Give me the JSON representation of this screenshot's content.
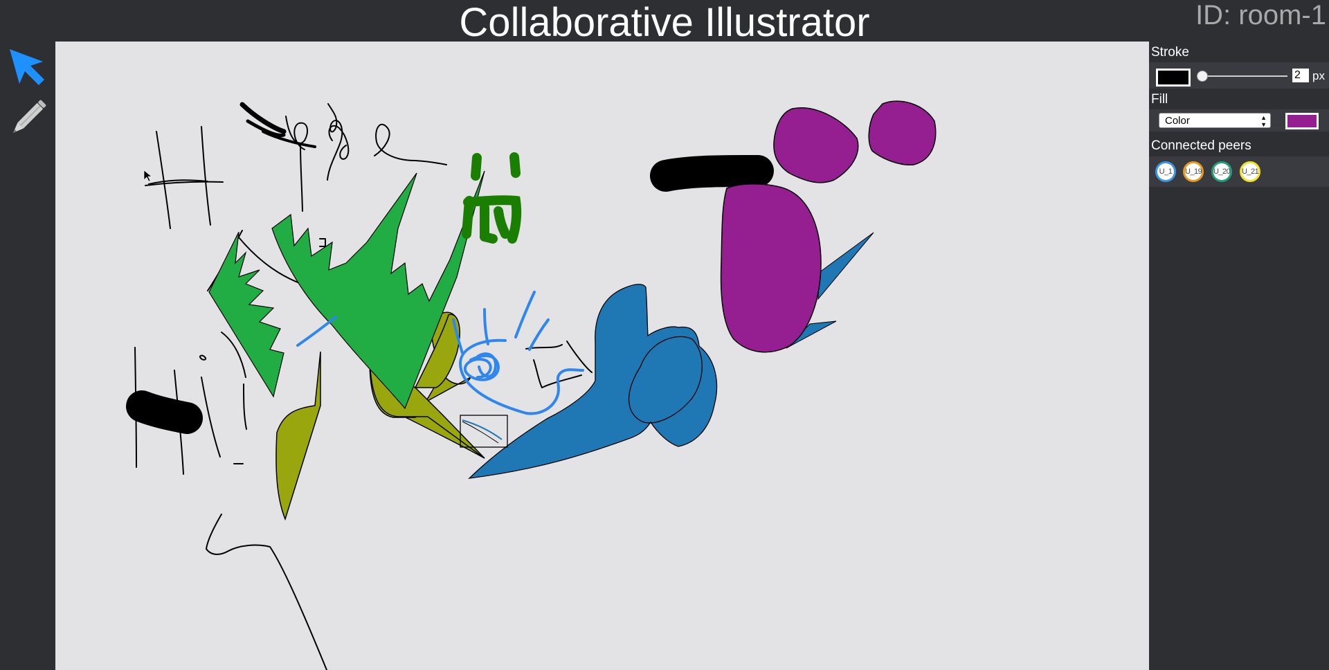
{
  "header": {
    "title": "Collaborative Illustrator",
    "room_id": "ID: room-1"
  },
  "toolbar": {
    "tools": [
      {
        "name": "select-tool",
        "icon": "cursor-arrow-icon",
        "color": "#1e90ff",
        "active": true
      },
      {
        "name": "pencil-tool",
        "icon": "pencil-icon",
        "color": "#cfcfcf",
        "active": false
      }
    ]
  },
  "panel": {
    "stroke": {
      "title": "Stroke",
      "color": "#000000",
      "width_value": "2",
      "unit": "px"
    },
    "fill": {
      "title": "Fill",
      "mode": "Color",
      "color": "#951e91"
    },
    "peers": {
      "title": "Connected peers",
      "list": [
        {
          "label": "U_1",
          "color": "#3b97e3"
        },
        {
          "label": "U_19",
          "color": "#e69a1c"
        },
        {
          "label": "U_20",
          "color": "#20a07a"
        },
        {
          "label": "U_21",
          "color": "#f0e228"
        }
      ]
    }
  },
  "canvas": {
    "background": "#e3e3e5",
    "palette": {
      "green": "#22ad44",
      "dark_green": "#1a7e00",
      "olive": "#9aa60e",
      "blue_fill": "#1f78b4",
      "blue_stroke": "#2f86ec",
      "purple": "#951e91",
      "black": "#000000"
    }
  }
}
